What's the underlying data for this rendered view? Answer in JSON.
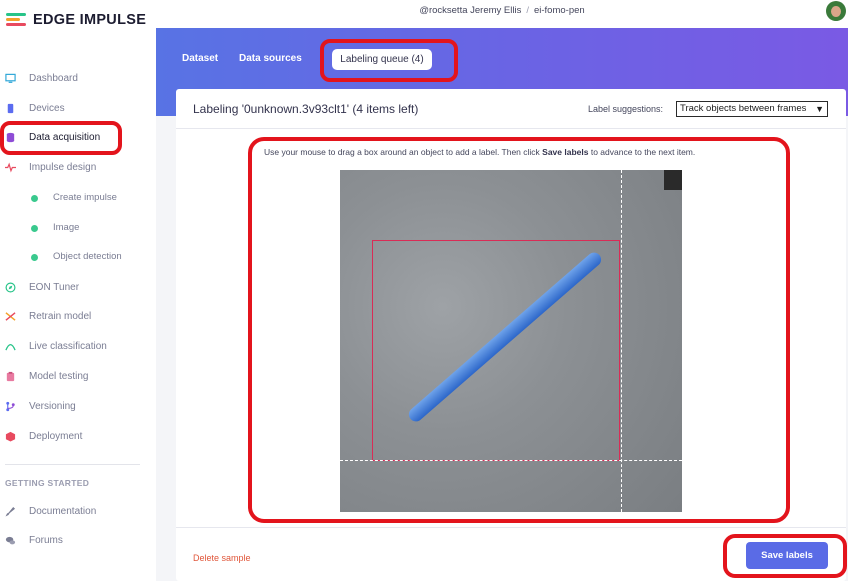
{
  "app": {
    "logo_text": "EDGE IMPULSE",
    "accent": "#5a6be6",
    "annotation_color": "#e3141c"
  },
  "topbar": {
    "user": "@rocksetta Jeremy Ellis",
    "project": "ei-fomo-pen"
  },
  "sidebar": {
    "items": [
      {
        "label": "Dashboard",
        "icon": "monitor-icon"
      },
      {
        "label": "Devices",
        "icon": "chip-icon"
      },
      {
        "label": "Data acquisition",
        "icon": "database-icon"
      },
      {
        "label": "Impulse design",
        "icon": "pulse-icon"
      },
      {
        "label": "Create impulse",
        "icon": "dot-icon"
      },
      {
        "label": "Image",
        "icon": "dot-icon"
      },
      {
        "label": "Object detection",
        "icon": "dot-icon"
      },
      {
        "label": "EON Tuner",
        "icon": "compass-icon"
      },
      {
        "label": "Retrain model",
        "icon": "shuffle-icon"
      },
      {
        "label": "Live classification",
        "icon": "wave-icon"
      },
      {
        "label": "Model testing",
        "icon": "clipboard-icon"
      },
      {
        "label": "Versioning",
        "icon": "branch-icon"
      },
      {
        "label": "Deployment",
        "icon": "box-icon"
      }
    ],
    "section_title": "GETTING STARTED",
    "help_items": [
      {
        "label": "Documentation",
        "icon": "rocket-icon"
      },
      {
        "label": "Forums",
        "icon": "chat-icon"
      }
    ]
  },
  "tabs": {
    "dataset": "Dataset",
    "data_sources": "Data sources",
    "labeling_queue": "Labeling queue (4)"
  },
  "card": {
    "title": "Labeling '0unknown.3v93clt1' (4 items left)",
    "suggestions_label": "Label suggestions:",
    "suggestions_value": "Track objects between frames",
    "hint_prefix": "Use your mouse to drag a box around an object to add a label. Then click ",
    "hint_bold": "Save labels",
    "hint_suffix": " to advance to the next item.",
    "delete_label": "Delete sample",
    "save_label": "Save labels"
  }
}
